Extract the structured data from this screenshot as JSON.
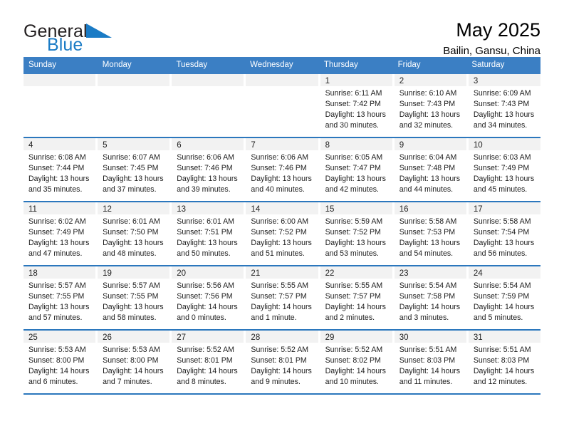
{
  "brand": {
    "word1": "General",
    "word2": "Blue",
    "flag_color": "#1a7bc5"
  },
  "header": {
    "title": "May 2025",
    "location": "Bailin, Gansu, China"
  },
  "theme": {
    "header_bar": "#3b7fc4",
    "row_divider": "#2b77bd",
    "daynum_band": "#f2f2f2"
  },
  "weekdays": [
    "Sunday",
    "Monday",
    "Tuesday",
    "Wednesday",
    "Thursday",
    "Friday",
    "Saturday"
  ],
  "weeks": [
    [
      {
        "day": "",
        "empty": true
      },
      {
        "day": "",
        "empty": true
      },
      {
        "day": "",
        "empty": true
      },
      {
        "day": "",
        "empty": true
      },
      {
        "day": "1",
        "sunrise": "Sunrise: 6:11 AM",
        "sunset": "Sunset: 7:42 PM",
        "daylight": "Daylight: 13 hours and 30 minutes."
      },
      {
        "day": "2",
        "sunrise": "Sunrise: 6:10 AM",
        "sunset": "Sunset: 7:43 PM",
        "daylight": "Daylight: 13 hours and 32 minutes."
      },
      {
        "day": "3",
        "sunrise": "Sunrise: 6:09 AM",
        "sunset": "Sunset: 7:43 PM",
        "daylight": "Daylight: 13 hours and 34 minutes."
      }
    ],
    [
      {
        "day": "4",
        "sunrise": "Sunrise: 6:08 AM",
        "sunset": "Sunset: 7:44 PM",
        "daylight": "Daylight: 13 hours and 35 minutes."
      },
      {
        "day": "5",
        "sunrise": "Sunrise: 6:07 AM",
        "sunset": "Sunset: 7:45 PM",
        "daylight": "Daylight: 13 hours and 37 minutes."
      },
      {
        "day": "6",
        "sunrise": "Sunrise: 6:06 AM",
        "sunset": "Sunset: 7:46 PM",
        "daylight": "Daylight: 13 hours and 39 minutes."
      },
      {
        "day": "7",
        "sunrise": "Sunrise: 6:06 AM",
        "sunset": "Sunset: 7:46 PM",
        "daylight": "Daylight: 13 hours and 40 minutes."
      },
      {
        "day": "8",
        "sunrise": "Sunrise: 6:05 AM",
        "sunset": "Sunset: 7:47 PM",
        "daylight": "Daylight: 13 hours and 42 minutes."
      },
      {
        "day": "9",
        "sunrise": "Sunrise: 6:04 AM",
        "sunset": "Sunset: 7:48 PM",
        "daylight": "Daylight: 13 hours and 44 minutes."
      },
      {
        "day": "10",
        "sunrise": "Sunrise: 6:03 AM",
        "sunset": "Sunset: 7:49 PM",
        "daylight": "Daylight: 13 hours and 45 minutes."
      }
    ],
    [
      {
        "day": "11",
        "sunrise": "Sunrise: 6:02 AM",
        "sunset": "Sunset: 7:49 PM",
        "daylight": "Daylight: 13 hours and 47 minutes."
      },
      {
        "day": "12",
        "sunrise": "Sunrise: 6:01 AM",
        "sunset": "Sunset: 7:50 PM",
        "daylight": "Daylight: 13 hours and 48 minutes."
      },
      {
        "day": "13",
        "sunrise": "Sunrise: 6:01 AM",
        "sunset": "Sunset: 7:51 PM",
        "daylight": "Daylight: 13 hours and 50 minutes."
      },
      {
        "day": "14",
        "sunrise": "Sunrise: 6:00 AM",
        "sunset": "Sunset: 7:52 PM",
        "daylight": "Daylight: 13 hours and 51 minutes."
      },
      {
        "day": "15",
        "sunrise": "Sunrise: 5:59 AM",
        "sunset": "Sunset: 7:52 PM",
        "daylight": "Daylight: 13 hours and 53 minutes."
      },
      {
        "day": "16",
        "sunrise": "Sunrise: 5:58 AM",
        "sunset": "Sunset: 7:53 PM",
        "daylight": "Daylight: 13 hours and 54 minutes."
      },
      {
        "day": "17",
        "sunrise": "Sunrise: 5:58 AM",
        "sunset": "Sunset: 7:54 PM",
        "daylight": "Daylight: 13 hours and 56 minutes."
      }
    ],
    [
      {
        "day": "18",
        "sunrise": "Sunrise: 5:57 AM",
        "sunset": "Sunset: 7:55 PM",
        "daylight": "Daylight: 13 hours and 57 minutes."
      },
      {
        "day": "19",
        "sunrise": "Sunrise: 5:57 AM",
        "sunset": "Sunset: 7:55 PM",
        "daylight": "Daylight: 13 hours and 58 minutes."
      },
      {
        "day": "20",
        "sunrise": "Sunrise: 5:56 AM",
        "sunset": "Sunset: 7:56 PM",
        "daylight": "Daylight: 14 hours and 0 minutes."
      },
      {
        "day": "21",
        "sunrise": "Sunrise: 5:55 AM",
        "sunset": "Sunset: 7:57 PM",
        "daylight": "Daylight: 14 hours and 1 minute."
      },
      {
        "day": "22",
        "sunrise": "Sunrise: 5:55 AM",
        "sunset": "Sunset: 7:57 PM",
        "daylight": "Daylight: 14 hours and 2 minutes."
      },
      {
        "day": "23",
        "sunrise": "Sunrise: 5:54 AM",
        "sunset": "Sunset: 7:58 PM",
        "daylight": "Daylight: 14 hours and 3 minutes."
      },
      {
        "day": "24",
        "sunrise": "Sunrise: 5:54 AM",
        "sunset": "Sunset: 7:59 PM",
        "daylight": "Daylight: 14 hours and 5 minutes."
      }
    ],
    [
      {
        "day": "25",
        "sunrise": "Sunrise: 5:53 AM",
        "sunset": "Sunset: 8:00 PM",
        "daylight": "Daylight: 14 hours and 6 minutes."
      },
      {
        "day": "26",
        "sunrise": "Sunrise: 5:53 AM",
        "sunset": "Sunset: 8:00 PM",
        "daylight": "Daylight: 14 hours and 7 minutes."
      },
      {
        "day": "27",
        "sunrise": "Sunrise: 5:52 AM",
        "sunset": "Sunset: 8:01 PM",
        "daylight": "Daylight: 14 hours and 8 minutes."
      },
      {
        "day": "28",
        "sunrise": "Sunrise: 5:52 AM",
        "sunset": "Sunset: 8:01 PM",
        "daylight": "Daylight: 14 hours and 9 minutes."
      },
      {
        "day": "29",
        "sunrise": "Sunrise: 5:52 AM",
        "sunset": "Sunset: 8:02 PM",
        "daylight": "Daylight: 14 hours and 10 minutes."
      },
      {
        "day": "30",
        "sunrise": "Sunrise: 5:51 AM",
        "sunset": "Sunset: 8:03 PM",
        "daylight": "Daylight: 14 hours and 11 minutes."
      },
      {
        "day": "31",
        "sunrise": "Sunrise: 5:51 AM",
        "sunset": "Sunset: 8:03 PM",
        "daylight": "Daylight: 14 hours and 12 minutes."
      }
    ]
  ]
}
